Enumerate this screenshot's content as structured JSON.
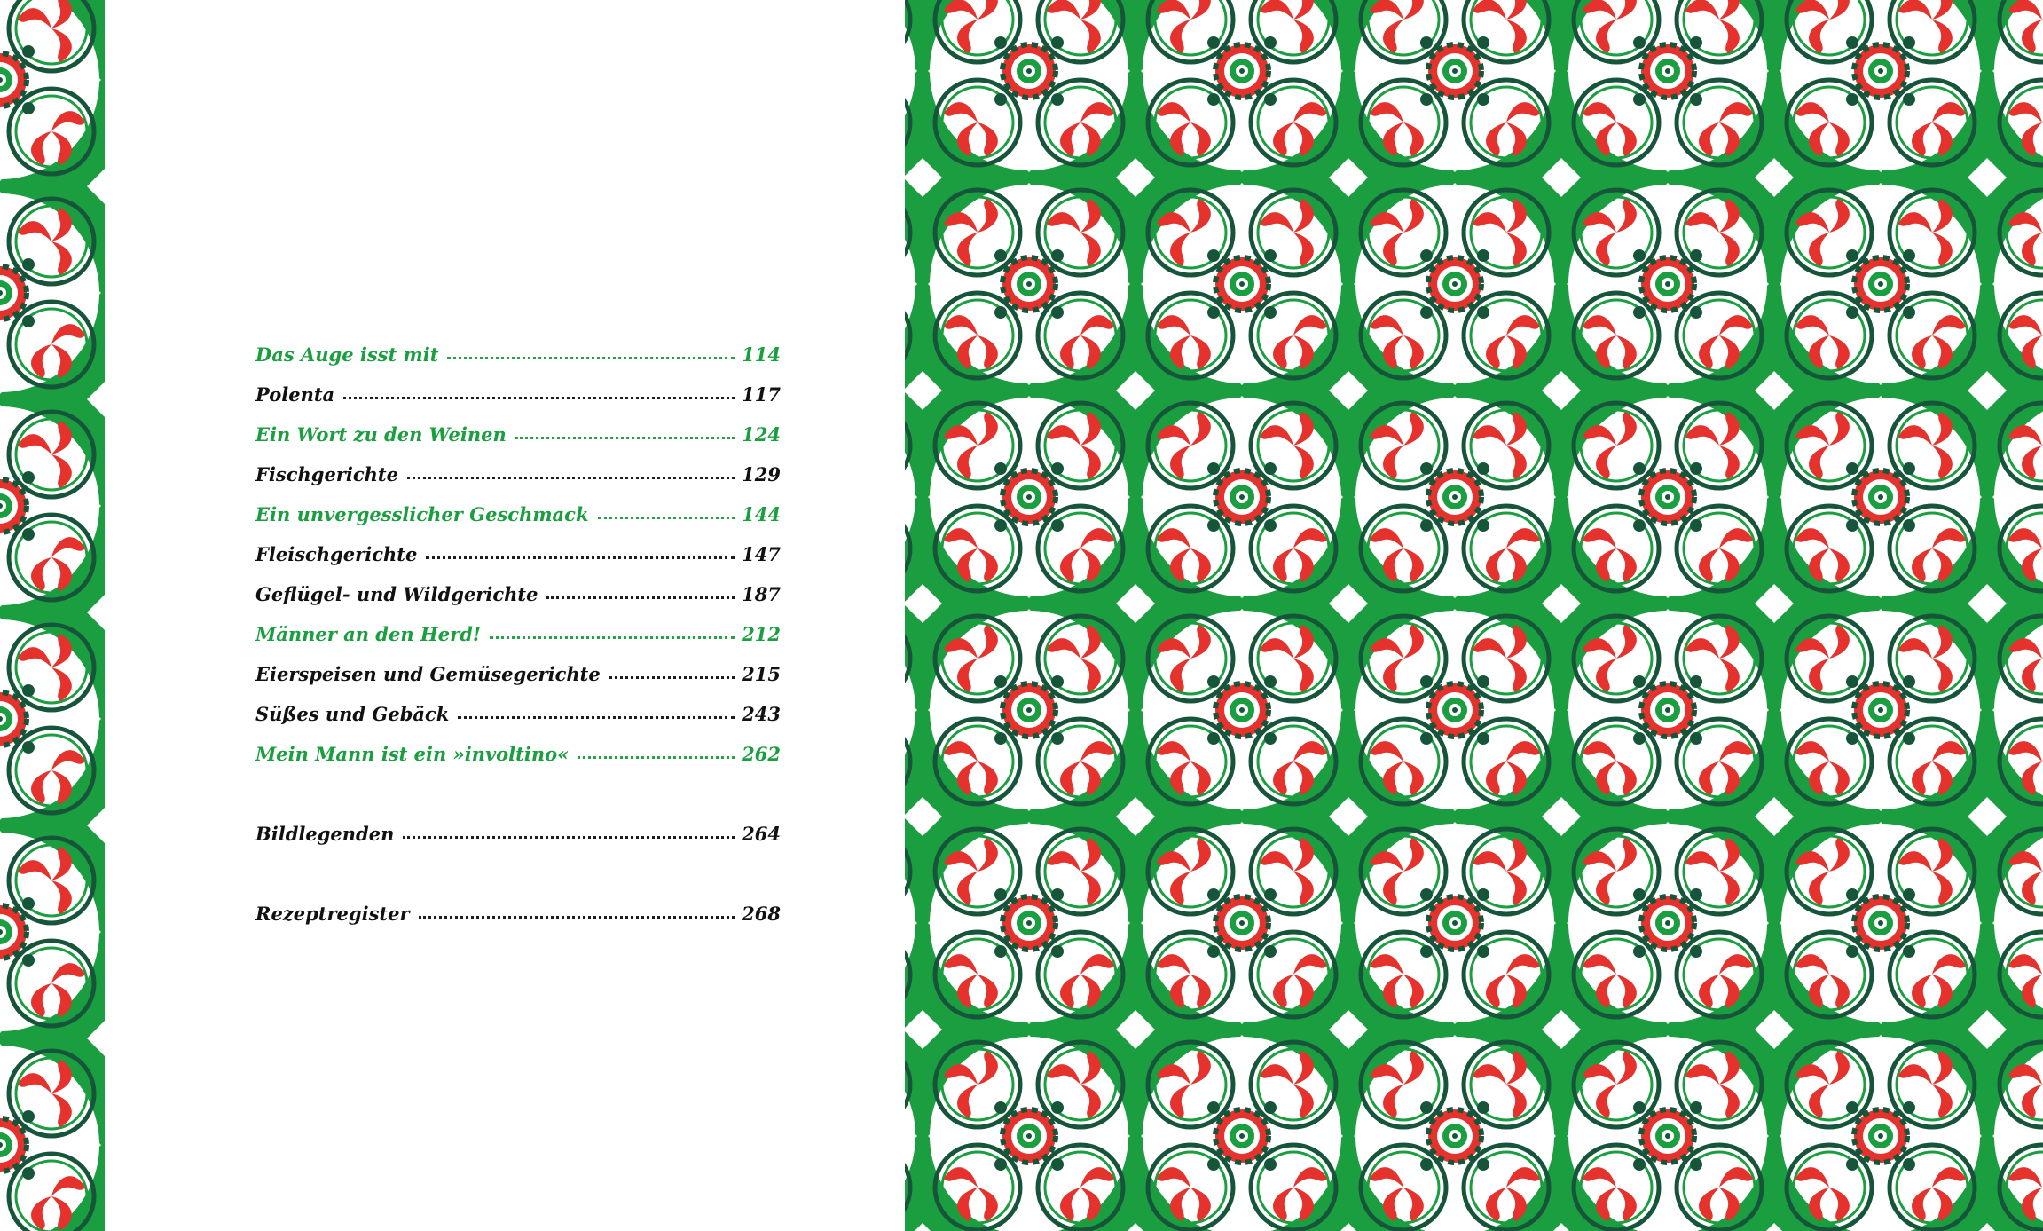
{
  "colors": {
    "accent_green": "#1a9e3f",
    "dark_green": "#17553a",
    "ornament_red": "#e5322d",
    "text_black": "#111111",
    "paper": "#ffffff"
  },
  "toc": {
    "entries": [
      {
        "title": "Das Auge isst mit",
        "page": "114",
        "style": "green"
      },
      {
        "title": "Polenta",
        "page": "117",
        "style": "black"
      },
      {
        "title": "Ein Wort zu den Weinen",
        "page": "124",
        "style": "green"
      },
      {
        "title": "Fischgerichte",
        "page": "129",
        "style": "black"
      },
      {
        "title": "Ein unvergesslicher Geschmack",
        "page": "144",
        "style": "green"
      },
      {
        "title": "Fleischgerichte",
        "page": "147",
        "style": "black"
      },
      {
        "title": "Geflügel- und Wildgerichte",
        "page": "187",
        "style": "black"
      },
      {
        "title": "Männer an den Herd!",
        "page": "212",
        "style": "green"
      },
      {
        "title": "Eierspeisen und Gemüsegerichte",
        "page": "215",
        "style": "black"
      },
      {
        "title": "Süßes und Gebäck",
        "page": "243",
        "style": "black"
      },
      {
        "title": "Mein Mann ist ein »involtino«",
        "page": "262",
        "style": "green"
      },
      {
        "title": "Bildlegenden",
        "page": "264",
        "style": "black"
      },
      {
        "title": "Rezeptregister",
        "page": "268",
        "style": "black"
      }
    ]
  },
  "decoration": {
    "left_border": "green-red-floral-tile-border",
    "right_panel": "green-red-floral-tile-pattern"
  }
}
